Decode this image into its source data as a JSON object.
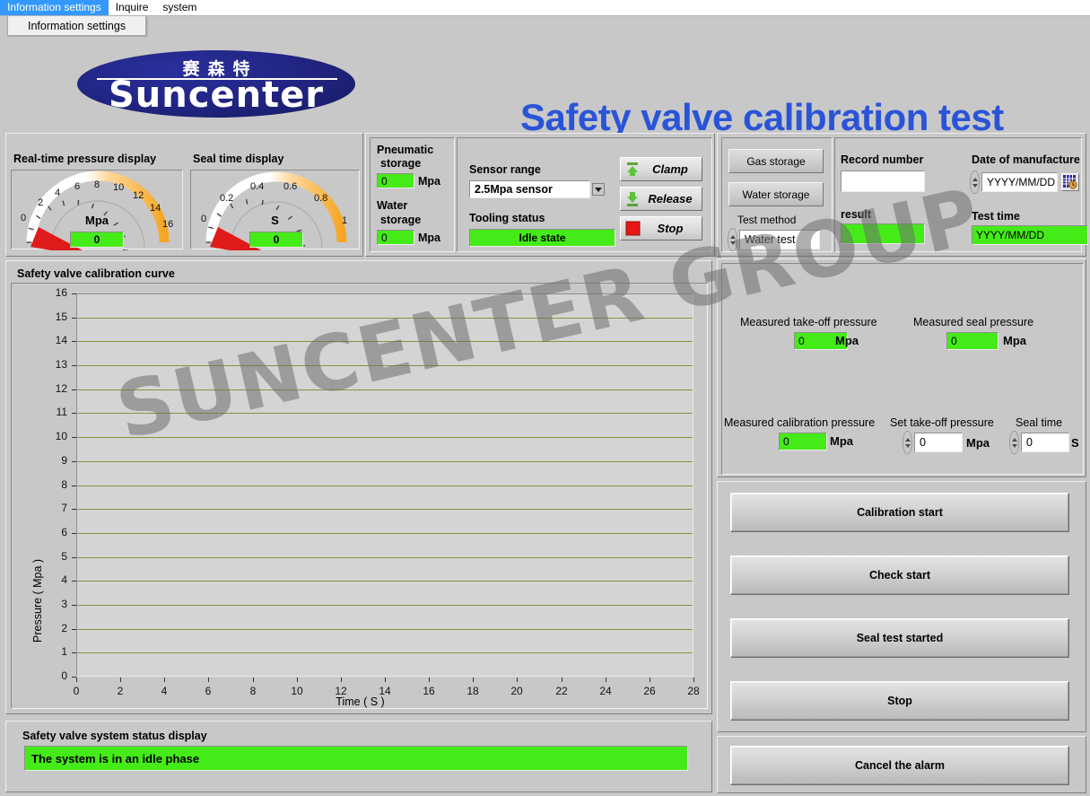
{
  "menubar": {
    "items": [
      {
        "label": "Information settings",
        "active": true
      },
      {
        "label": "Inquire",
        "active": false
      },
      {
        "label": "system",
        "active": false
      }
    ],
    "dropdown_item": "Information settings"
  },
  "header": {
    "logo_cn": "赛森特",
    "logo_en": "Suncenter",
    "title": "Safety valve calibration test"
  },
  "gauges": {
    "pressure": {
      "label": "Real-time pressure display",
      "unit": "Mpa",
      "value": "0",
      "ticks": [
        "0",
        "2",
        "4",
        "6",
        "8",
        "10",
        "12",
        "14",
        "16"
      ],
      "min": 0,
      "max": 16
    },
    "seal": {
      "label": "Seal time display",
      "unit": "S",
      "value": "0",
      "ticks": [
        "0",
        "0.2",
        "0.4",
        "0.6",
        "0.8",
        "1"
      ],
      "min": 0,
      "max": 1
    }
  },
  "storage": {
    "pneumatic_label": "Pneumatic\nstorage",
    "pneumatic_label_l1": "Pneumatic",
    "pneumatic_label_l2": "storage",
    "pneumatic_value": "0",
    "pneumatic_unit": "Mpa",
    "water_label_l1": "Water",
    "water_label_l2": "storage",
    "water_value": "0",
    "water_unit": "Mpa"
  },
  "sensor": {
    "range_label": "Sensor range",
    "range_value": "2.5Mpa sensor",
    "tooling_label": "Tooling status",
    "tooling_value": "Idle state"
  },
  "actions": {
    "clamp": "Clamp",
    "release": "Release",
    "stop": "Stop"
  },
  "storage_buttons": {
    "gas": "Gas storage",
    "water": "Water storage",
    "test_method_label": "Test method",
    "test_method_value": "Water test"
  },
  "record": {
    "record_number_label": "Record number",
    "record_number_value": "",
    "result_label": "result",
    "result_value": "",
    "date_label": "Date of manufacture",
    "date_value": "YYYY/MM/DD",
    "test_time_label": "Test time",
    "test_time_value": "YYYY/MM/DD"
  },
  "chart_panel": {
    "title": "Safety valve calibration curve"
  },
  "chart_data": {
    "type": "line",
    "title": "Safety valve calibration curve",
    "xlabel": "Time ( S )",
    "ylabel": "Pressure ( Mpa )",
    "xlim": [
      0,
      28
    ],
    "ylim": [
      0,
      16
    ],
    "xticks": [
      0,
      2,
      4,
      6,
      8,
      10,
      12,
      14,
      16,
      18,
      20,
      22,
      24,
      26,
      28
    ],
    "yticks": [
      0,
      1,
      2,
      3,
      4,
      5,
      6,
      7,
      8,
      9,
      10,
      11,
      12,
      13,
      14,
      15,
      16
    ],
    "grid": true,
    "grid_color": "#8f8f3c",
    "plot_bg": "#d4d4d4",
    "series": [
      {
        "name": "Pressure",
        "x": [],
        "y": []
      }
    ]
  },
  "watermark": "SUNCENTER GROUP",
  "measured": {
    "takeoff_label": "Measured take-off pressure",
    "takeoff_value": "0",
    "takeoff_unit": "Mpa",
    "seal_label": "Measured seal pressure",
    "seal_value": "0",
    "seal_unit": "Mpa",
    "calibration_label": "Measured calibration pressure",
    "calibration_value": "0",
    "calibration_unit": "Mpa",
    "set_takeoff_label": "Set take-off pressure",
    "set_takeoff_value": "0",
    "set_takeoff_unit": "Mpa",
    "seal_time_label": "Seal time",
    "seal_time_value": "0",
    "seal_time_unit": "S"
  },
  "main_buttons": [
    {
      "label": "Calibration start"
    },
    {
      "label": "Check start"
    },
    {
      "label": "Seal test started"
    },
    {
      "label": "Stop"
    }
  ],
  "alarm_button": {
    "label": "Cancel the alarm"
  },
  "status": {
    "label": "Safety valve system status display",
    "message": "The system is in an idle phase"
  },
  "colors": {
    "accent_blue": "#2a54d8",
    "indicator_green": "#45eb18",
    "logo_blue": "#20247f",
    "grid_olive": "#8f8f3c",
    "needle_red": "#e01b1b",
    "gauge_orange": "#f5a623",
    "menu_highlight": "#3399ff"
  }
}
